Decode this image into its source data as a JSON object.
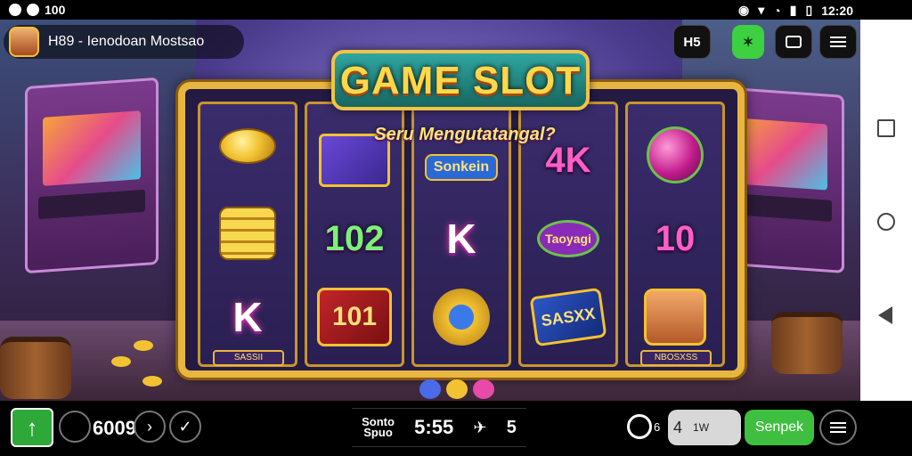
{
  "status_bar": {
    "left_text": "100",
    "time": "12:20"
  },
  "header": {
    "app_title": "H89 - Ienodoan Mostsao",
    "h5_label": "H5"
  },
  "game": {
    "title": "GAME SLOT",
    "subtitle": "Seru Mengutatangal?",
    "reels": [
      {
        "symbols": [
          "coin",
          "coin-stack",
          "gem-k"
        ],
        "plaque": "SASSII"
      },
      {
        "symbols": [
          "character-cards",
          "102",
          "101"
        ],
        "plaque": ""
      },
      {
        "symbols": [
          "Sonkein",
          "K",
          "lamp"
        ],
        "plaque": ""
      },
      {
        "symbols": [
          "4K",
          "Taoyagi",
          "SASXX"
        ],
        "plaque": ""
      },
      {
        "symbols": [
          "orb",
          "10",
          "character"
        ],
        "plaque": "NBOSXSS"
      }
    ],
    "reel2_mid": "102",
    "reel2_bot": "101",
    "reel3_top": "Sonkein",
    "reel3_mid": "K",
    "reel4_top": "4K",
    "reel4_mid": "Taoyagi",
    "reel4_bot": "SASXX",
    "reel5_mid": "10",
    "reel1_bot": "K",
    "plaque_left": "SASSII",
    "plaque_right": "NBOSXSS"
  },
  "bottom_bar": {
    "up_icon": "↑",
    "credit": "6009",
    "next_icon": "›",
    "check_icon": "✓",
    "center_label_top": "Sonto",
    "center_label_bottom": "Spuo",
    "center_time": "5:55",
    "center_count": "5",
    "timer_label": "6",
    "bet_value": "4",
    "bet_sub": "1W",
    "spin_label": "Senpek"
  },
  "colors": {
    "accent_gold": "#e8b640",
    "spin_green": "#3fbf3f",
    "title_teal": "#2fa6a2"
  }
}
